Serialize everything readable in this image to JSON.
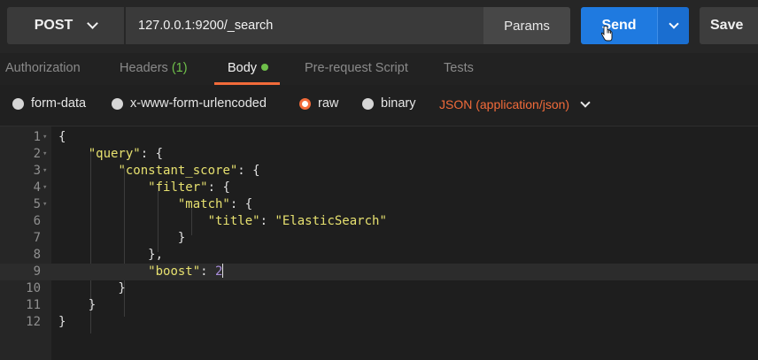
{
  "request": {
    "method": "POST",
    "url": "127.0.0.1:9200/_search",
    "params_label": "Params",
    "send_label": "Send",
    "save_label": "Save"
  },
  "tabs": [
    {
      "label": "Authorization"
    },
    {
      "label": "Headers",
      "count": "(1)"
    },
    {
      "label": "Body"
    },
    {
      "label": "Pre-request Script"
    },
    {
      "label": "Tests"
    }
  ],
  "body_types": [
    {
      "label": "form-data",
      "selected": false
    },
    {
      "label": "x-www-form-urlencoded",
      "selected": false
    },
    {
      "label": "raw",
      "selected": true
    },
    {
      "label": "binary",
      "selected": false
    }
  ],
  "content_type": "JSON (application/json)",
  "editor": {
    "lines": [
      {
        "n": "1",
        "text": "{"
      },
      {
        "n": "2",
        "text": "    \"query\": {"
      },
      {
        "n": "3",
        "text": "        \"constant_score\": {"
      },
      {
        "n": "4",
        "text": "            \"filter\": {"
      },
      {
        "n": "5",
        "text": "                \"match\": {"
      },
      {
        "n": "6",
        "text": "                    \"title\": \"ElasticSearch\""
      },
      {
        "n": "7",
        "text": "                }"
      },
      {
        "n": "8",
        "text": "            },"
      },
      {
        "n": "9",
        "text": "            \"boost\": 2"
      },
      {
        "n": "10",
        "text": "        }"
      },
      {
        "n": "11",
        "text": "    }"
      },
      {
        "n": "12",
        "text": "}"
      }
    ]
  },
  "colors": {
    "accent": "#f26b3a",
    "send_blue": "#1f7ae0",
    "json_key": "#e6e06f",
    "json_number": "#a98ddb"
  }
}
